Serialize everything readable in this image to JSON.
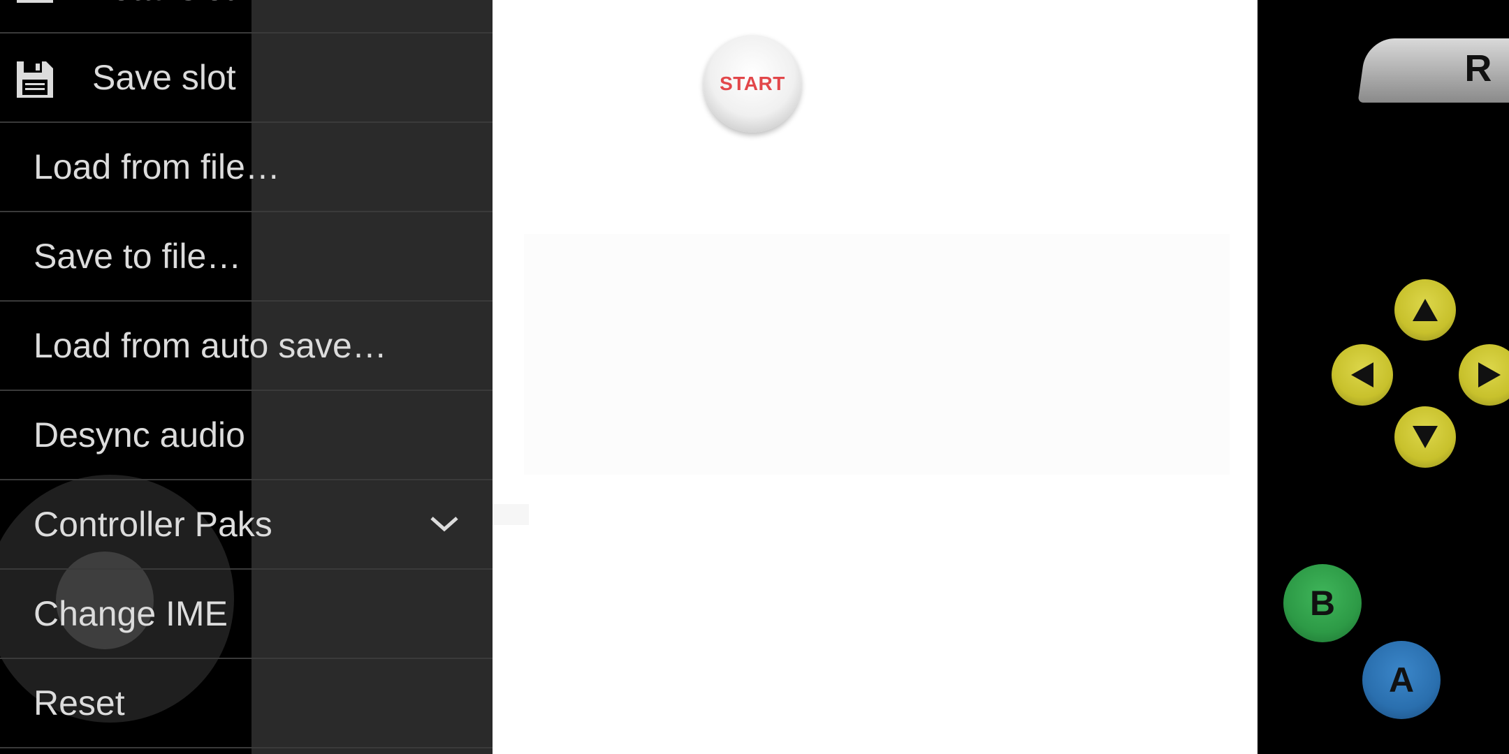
{
  "menu": {
    "items": [
      {
        "label": "Load slot",
        "icon": "folder-icon"
      },
      {
        "label": "Save slot",
        "icon": "floppy-disk-icon"
      },
      {
        "label": "Load from file…"
      },
      {
        "label": "Save to file…"
      },
      {
        "label": "Load from auto save…"
      },
      {
        "label": "Desync audio"
      },
      {
        "label": "Controller Paks",
        "icon": "chevron-down-icon"
      },
      {
        "label": "Change IME"
      },
      {
        "label": "Reset"
      }
    ]
  },
  "controls": {
    "start_label": "START",
    "r_label": "R",
    "b_label": "B",
    "a_label": "A",
    "c_buttons": [
      "c-up",
      "c-left",
      "c-right",
      "c-down"
    ]
  },
  "colors": {
    "drawer_bg": "#2a2a2a",
    "start_text": "#e2474a",
    "c_button": "#c8c12c",
    "b_button": "#2d9a46",
    "a_button": "#2a6fae"
  }
}
